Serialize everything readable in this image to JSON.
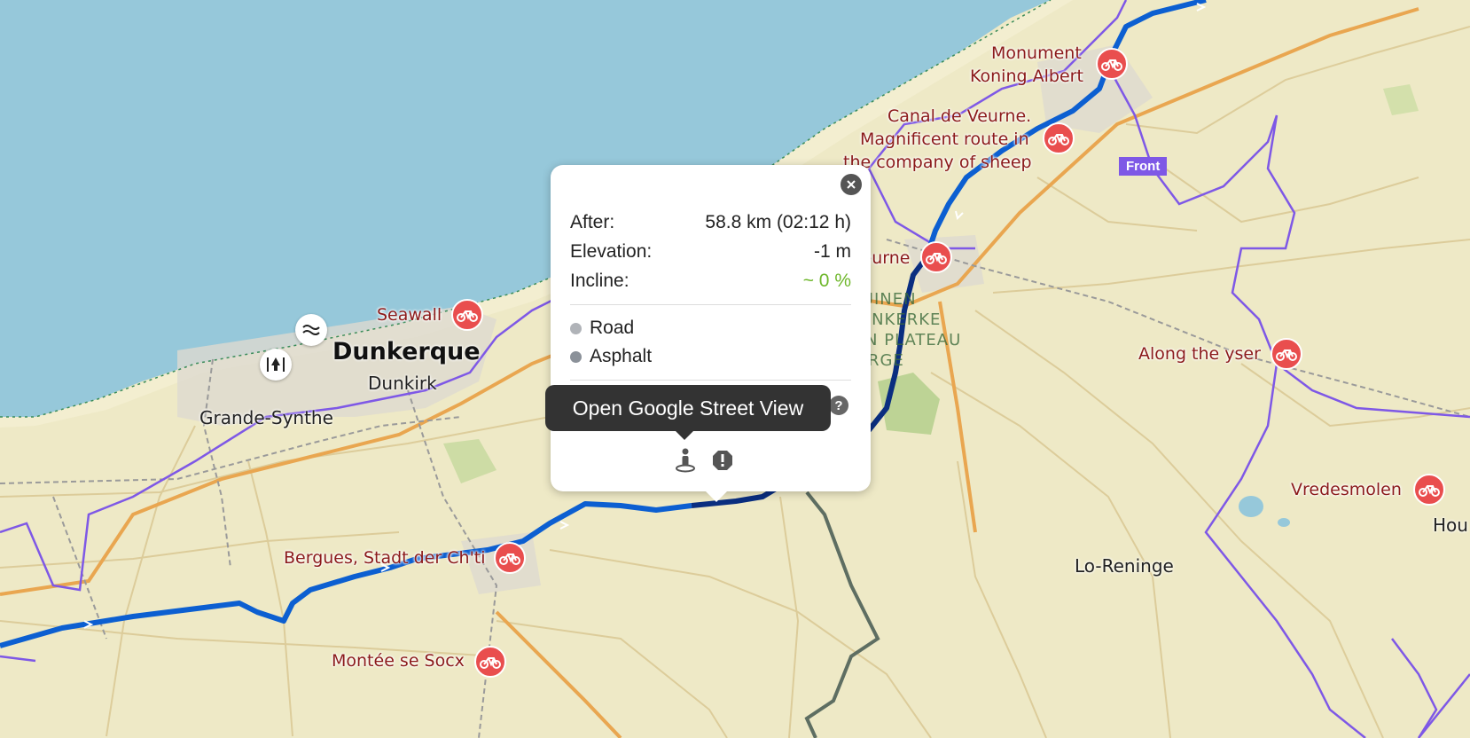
{
  "colors": {
    "sea": "#96c8da",
    "land": "#eee9c6",
    "route": "#0c5fd1",
    "route_dark": "#0a2e80",
    "boundary": "#7e58e6",
    "poi": "#e94e4e",
    "incline_green": "#6fb72c",
    "road_dot": "#b0b3b8",
    "asphalt_dot": "#8b9199"
  },
  "map_labels": {
    "monument": [
      "Monument",
      "Koning Albert"
    ],
    "canal": [
      "Canal de Veurne.",
      "Magnificent route in",
      "the company of sheep"
    ],
    "veurne": "Veurne",
    "seawall": "Seawall",
    "dunkerque": "Dunkerque",
    "dunkirk": "Dunkirk",
    "grande_synthe": "Grande-Synthe",
    "bergues": "Bergues, Stadt der Ch'ti",
    "montee": "Montée se Socx",
    "along_yser": "Along the yser",
    "vredesmolen": "Vredesmolen",
    "hou": "Hou",
    "lo_reninge": "Lo-Reninge",
    "front": "Front",
    "nature": [
      "WESTHOEKDUINEN",
      "DUINEN VAN ADINKERKE",
      "EN DE MOEREN EN PLATEAU",
      "VAN IZENBERGE"
    ]
  },
  "popup": {
    "after_label": "After:",
    "after_value": "58.8 km (02:12 h)",
    "elevation_label": "Elevation:",
    "elevation_value": "-1 m",
    "incline_label": "Incline:",
    "incline_value": "~ 0 %",
    "surfaces": [
      "Road",
      "Asphalt"
    ],
    "help_icon": "?"
  },
  "tooltip": {
    "text": "Open Google Street View"
  },
  "icons": {
    "close": "close-icon",
    "street_view": "street-view-icon",
    "report": "report-icon",
    "poi": "bicycle-icon"
  }
}
